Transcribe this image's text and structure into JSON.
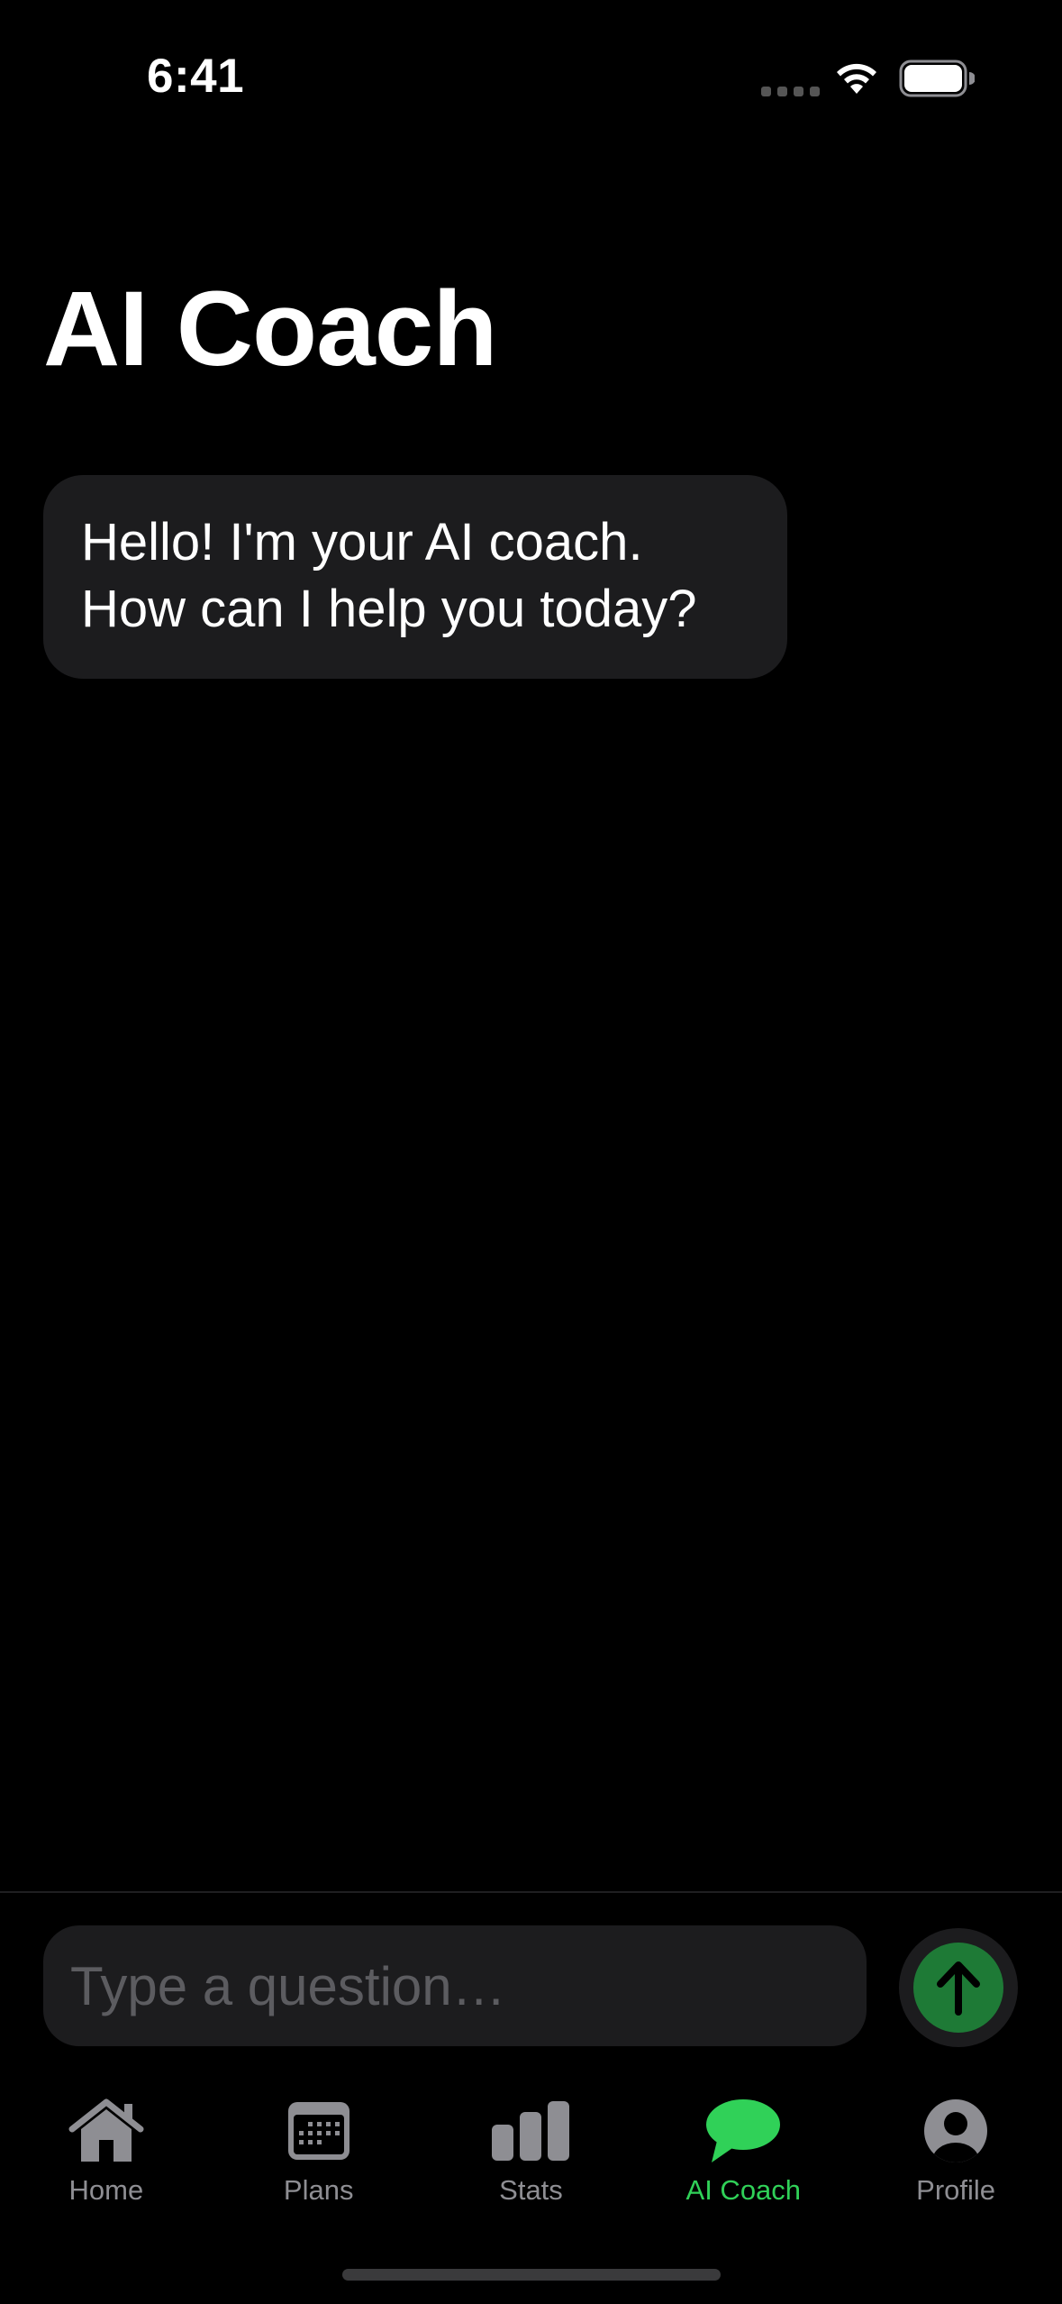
{
  "status_bar": {
    "time": "6:41"
  },
  "header": {
    "title": "AI Coach"
  },
  "chat": {
    "messages": [
      {
        "role": "assistant",
        "text_line1": "Hello! I'm your AI coach.",
        "text_line2": "How can I help you today?"
      }
    ]
  },
  "composer": {
    "placeholder": "Type a question…",
    "value": "",
    "send_icon": "arrow-up-icon"
  },
  "tab_bar": {
    "items": [
      {
        "label": "Home",
        "icon": "house-icon",
        "active": false
      },
      {
        "label": "Plans",
        "icon": "calendar-icon",
        "active": false
      },
      {
        "label": "Stats",
        "icon": "bar-chart-icon",
        "active": false
      },
      {
        "label": "AI Coach",
        "icon": "chat-bubble-icon",
        "active": true
      },
      {
        "label": "Profile",
        "icon": "person-circle-icon",
        "active": false
      }
    ]
  },
  "colors": {
    "background": "#000000",
    "bubble": "#1c1c1e",
    "accent": "#30d158",
    "inactive": "#8e8e93"
  }
}
